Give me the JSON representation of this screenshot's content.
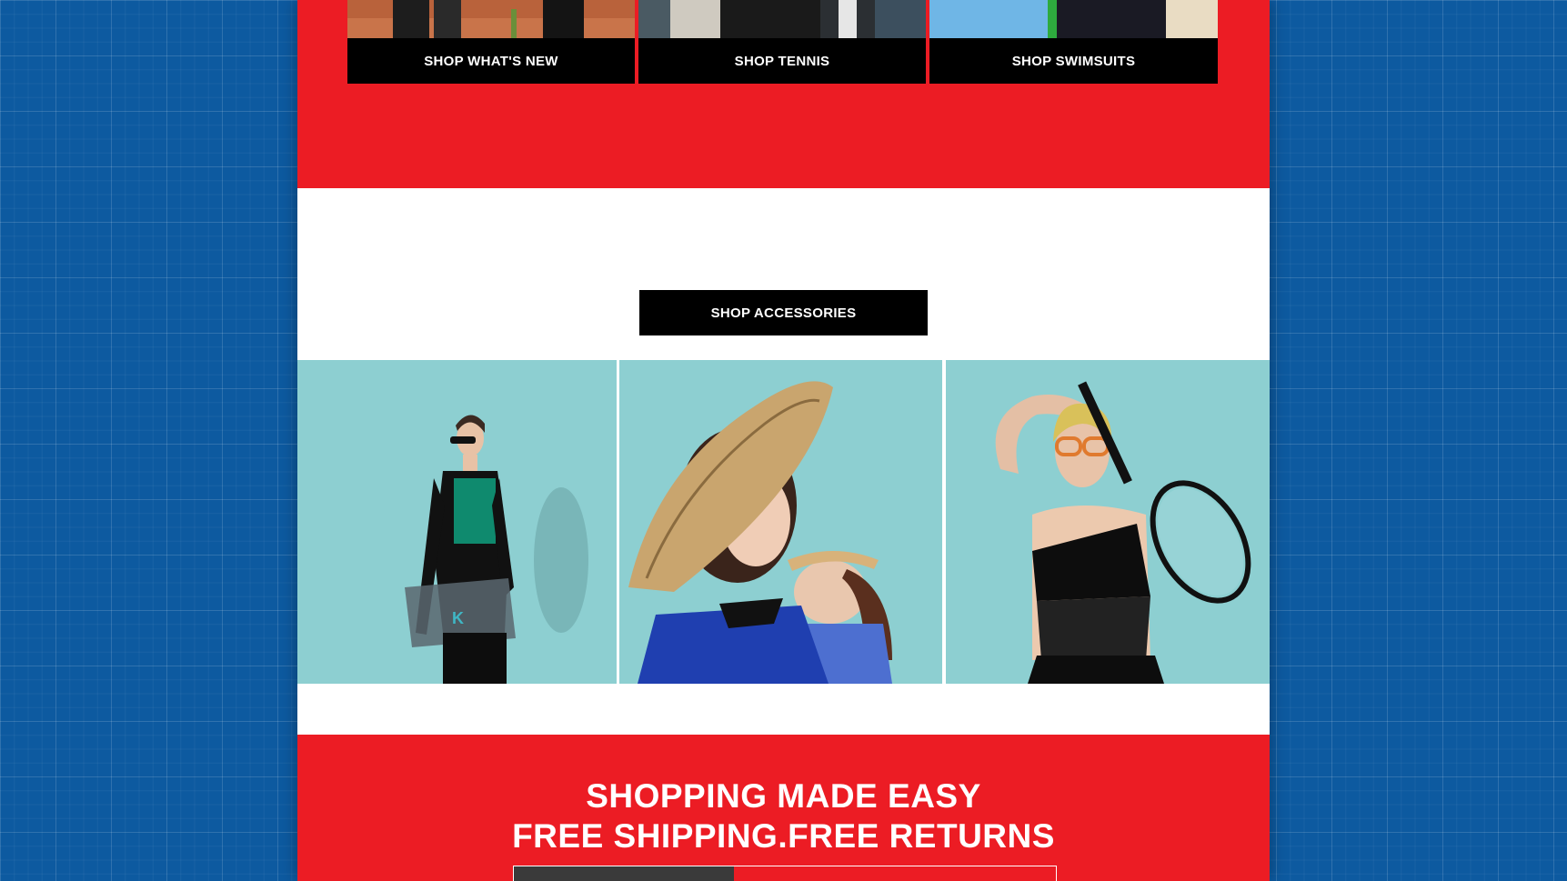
{
  "categories": [
    {
      "label": "SHOP WHAT'S NEW"
    },
    {
      "label": "SHOP TENNIS"
    },
    {
      "label": "SHOP SWIMSUITS"
    }
  ],
  "accessories": {
    "label": "SHOP ACCESSORIES"
  },
  "footer_banner": {
    "line1": "SHOPPING MADE EASY",
    "line2": "FREE SHIPPING.FREE RETURNS"
  },
  "colors": {
    "brand_red": "#ec1c24",
    "button_black": "#000000",
    "backdrop_blue": "#0d5aa0"
  }
}
